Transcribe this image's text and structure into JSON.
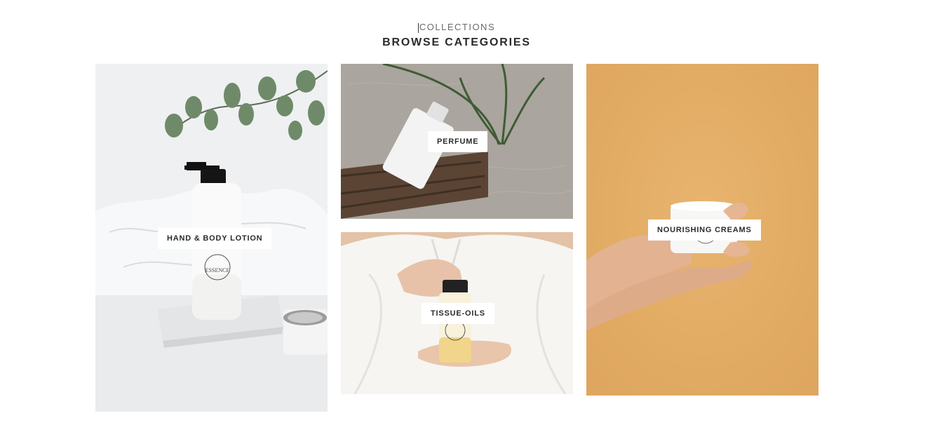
{
  "section": {
    "eyebrow": "COLLECTIONS",
    "title": "BROWSE CATEGORIES"
  },
  "categories": [
    {
      "label": "HAND & BODY LOTION",
      "bg": "#eceef0"
    },
    {
      "label": "PERFUME",
      "bg": "#a9a49c"
    },
    {
      "label": "TISSUE-OILS",
      "bg": "#e3c2a6"
    },
    {
      "label": "NOURISHING CREAMS",
      "bg": "#e3b06a"
    }
  ],
  "product_print": {
    "brand": "ESSENCE"
  }
}
